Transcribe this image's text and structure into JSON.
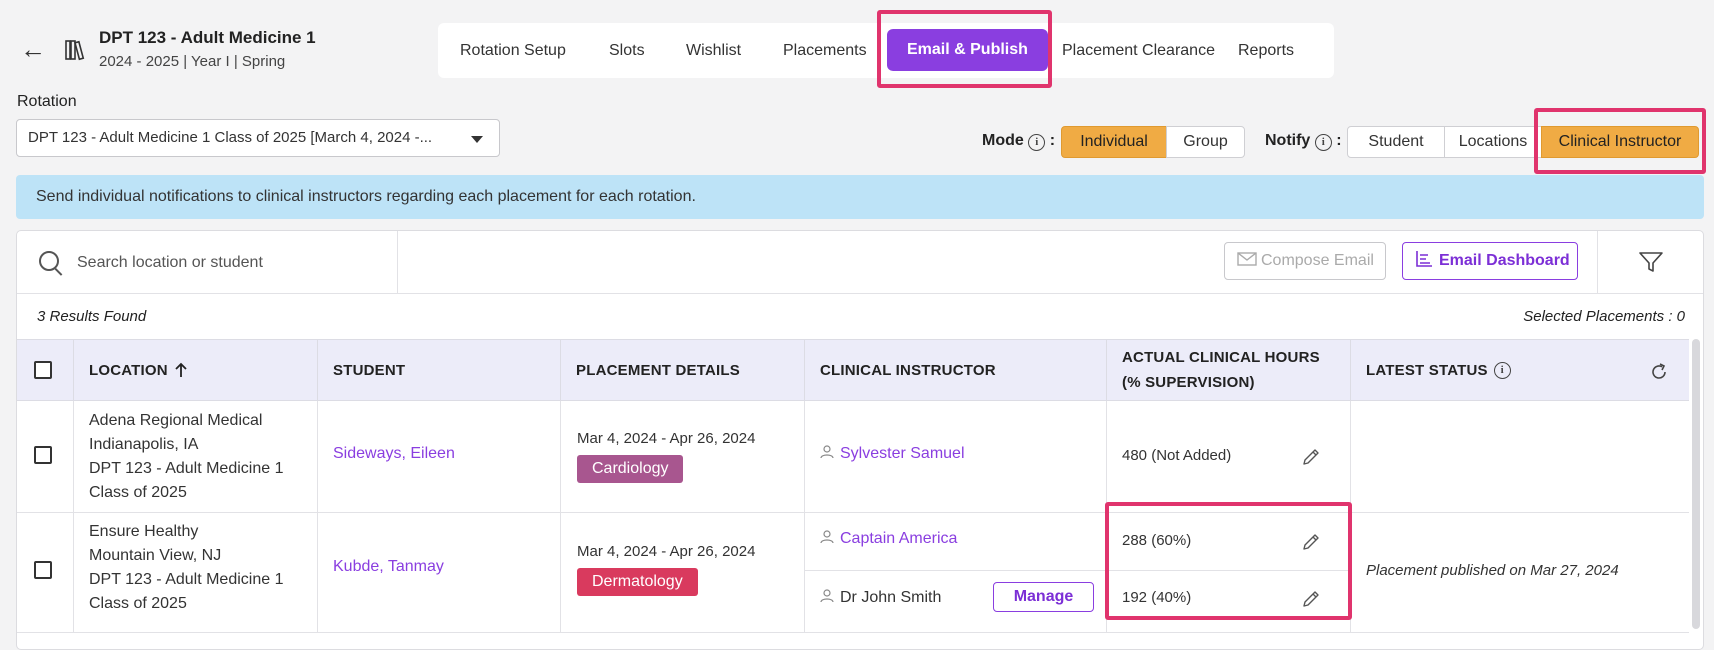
{
  "header": {
    "back_label": "←",
    "course_title": "DPT 123 - Adult Medicine 1",
    "course_subtitle": "2024 - 2025 | Year I | Spring"
  },
  "tabs": [
    {
      "label": "Rotation Setup"
    },
    {
      "label": "Slots"
    },
    {
      "label": "Wishlist"
    },
    {
      "label": "Placements"
    },
    {
      "label": "Email & Publish",
      "active": true
    },
    {
      "label": "Placement Clearance"
    },
    {
      "label": "Reports"
    }
  ],
  "rotation": {
    "label": "Rotation",
    "selected": "DPT 123 - Adult Medicine 1 Class of 2025 [March 4, 2024 -..."
  },
  "mode": {
    "label": "Mode",
    "options": [
      "Individual",
      "Group"
    ],
    "selected": "Individual"
  },
  "notify": {
    "label": "Notify",
    "colon": ":",
    "options": [
      "Student",
      "Locations",
      "Clinical Instructor"
    ],
    "selected": "Clinical Instructor"
  },
  "banner": "Send individual notifications to clinical instructors regarding each placement for each rotation.",
  "toolbar": {
    "search_placeholder": "Search location or student",
    "compose_label": "Compose Email",
    "dashboard_label": "Email Dashboard"
  },
  "results_text": "3 Results Found",
  "selected_text": "Selected Placements : 0",
  "columns": {
    "location": "LOCATION",
    "student": "STUDENT",
    "details": "PLACEMENT DETAILS",
    "instructor": "CLINICAL INSTRUCTOR",
    "hours_line1": "ACTUAL CLINICAL HOURS",
    "hours_line2": "(% SUPERVISION)",
    "status": "LATEST STATUS"
  },
  "rows": [
    {
      "location_name": "Adena Regional Medical",
      "location_city": "Indianapolis, IA",
      "location_course": "DPT 123 - Adult Medicine 1",
      "location_class": "Class of 2025",
      "student": "Sideways, Eileen",
      "dates": "Mar 4, 2024 - Apr 26, 2024",
      "specialty": "Cardiology",
      "specialty_color": "#a8568f",
      "instructors": [
        {
          "name": "Sylvester Samuel",
          "hours": "480 (Not Added)"
        }
      ],
      "status": ""
    },
    {
      "location_name": "Ensure Healthy",
      "location_city": "Mountain View, NJ",
      "location_course": "DPT 123 - Adult Medicine 1",
      "location_class": "Class of 2025",
      "student": "Kubde, Tanmay",
      "dates": "Mar 4, 2024 - Apr 26, 2024",
      "specialty": "Dermatology",
      "specialty_color": "#d93a5e",
      "instructors": [
        {
          "name": "Captain America",
          "hours": "288 (60%)"
        },
        {
          "name": "Dr John Smith",
          "hours": "192 (40%)",
          "manage_label": "Manage"
        }
      ],
      "status": "Placement published on Mar 27, 2024"
    }
  ],
  "colors": {
    "accent": "#8a3ee0",
    "highlight": "#e0346d",
    "toggle_on": "#f0ab44",
    "banner": "#bde3f7"
  }
}
